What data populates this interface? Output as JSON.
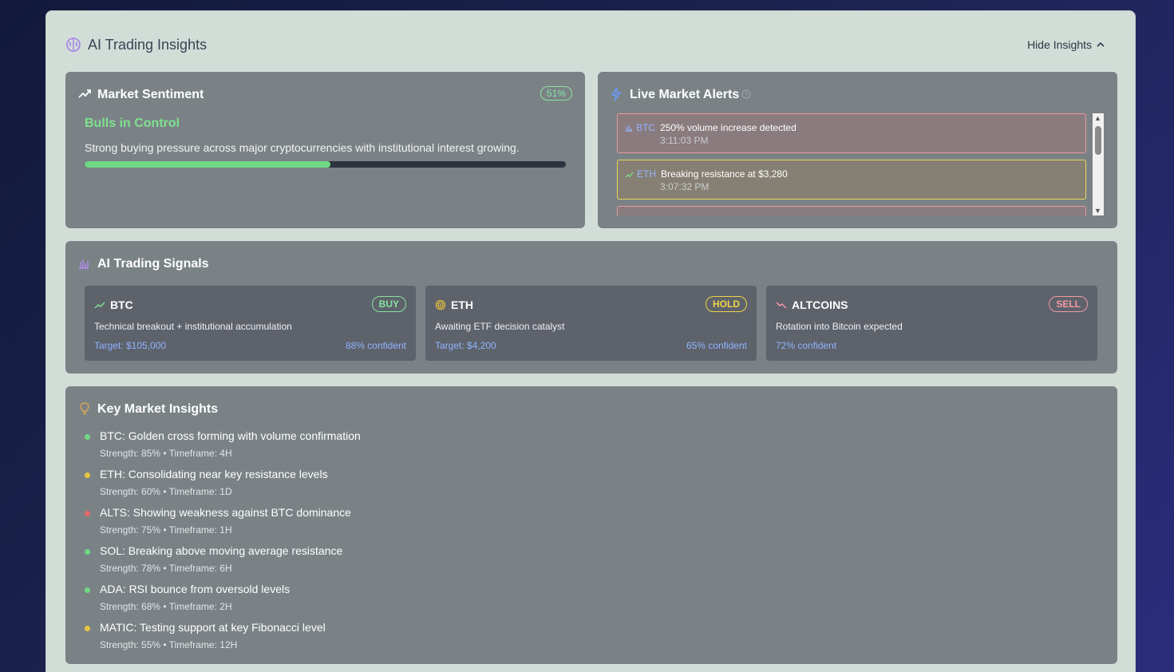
{
  "header": {
    "title": "AI Trading Insights",
    "hide_label": "Hide Insights"
  },
  "sentiment": {
    "title": "Market Sentiment",
    "percent_label": "51%",
    "percent": 51,
    "headline": "Bulls in Control",
    "description": "Strong buying pressure across major cryptocurrencies with institutional interest growing."
  },
  "alerts": {
    "title": "Live Market Alerts",
    "items": [
      {
        "symbol": "BTC",
        "message": "250% volume increase detected",
        "time": "3:11:03 PM",
        "kind": "volume"
      },
      {
        "symbol": "ETH",
        "message": "Breaking resistance at $3,280",
        "time": "3:07:32 PM",
        "kind": "trend"
      }
    ]
  },
  "signals": {
    "title": "AI Trading Signals",
    "items": [
      {
        "name": "BTC",
        "action": "BUY",
        "description": "Technical breakout + institutional accumulation",
        "target": "Target: $105,000",
        "confidence": "88% confident"
      },
      {
        "name": "ETH",
        "action": "HOLD",
        "description": "Awaiting ETF decision catalyst",
        "target": "Target: $4,200",
        "confidence": "65% confident"
      },
      {
        "name": "ALTCOINS",
        "action": "SELL",
        "description": "Rotation into Bitcoin expected",
        "confidence": "72% confident"
      }
    ]
  },
  "insights": {
    "title": "Key Market Insights",
    "items": [
      {
        "title": "BTC: Golden cross forming with volume confirmation",
        "meta": "Strength: 85% • Timeframe: 4H",
        "color": "#6fd882"
      },
      {
        "title": "ETH: Consolidating near key resistance levels",
        "meta": "Strength: 60% • Timeframe: 1D",
        "color": "#e8c53c"
      },
      {
        "title": "ALTS: Showing weakness against BTC dominance",
        "meta": "Strength: 75% • Timeframe: 1H",
        "color": "#e36a6a"
      },
      {
        "title": "SOL: Breaking above moving average resistance",
        "meta": "Strength: 78% • Timeframe: 6H",
        "color": "#6fd882"
      },
      {
        "title": "ADA: RSI bounce from oversold levels",
        "meta": "Strength: 68% • Timeframe: 2H",
        "color": "#6fd882"
      },
      {
        "title": "MATIC: Testing support at key Fibonacci level",
        "meta": "Strength: 55% • Timeframe: 12H",
        "color": "#e8c53c"
      }
    ]
  },
  "colors": {
    "buy": "#86e3a0",
    "hold": "#f0d24a",
    "sell": "#f29aa4",
    "accent_blue": "#90b4ff"
  }
}
